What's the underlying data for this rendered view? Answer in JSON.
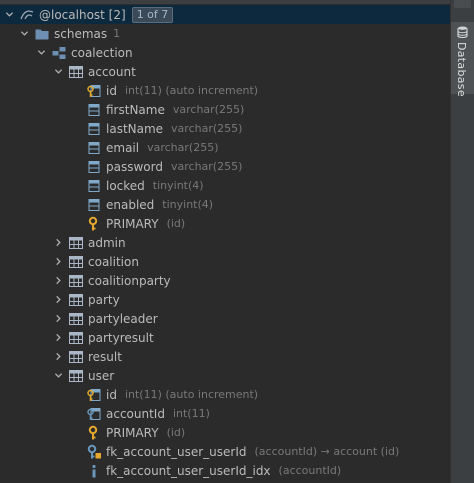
{
  "colors": {
    "background": "#2b2b2b",
    "selected_row": "#0d293e",
    "text": "#bbbbbb",
    "dim_text": "#787878",
    "key_icon": "#e3a82d",
    "table_icon": "#a9b7c6"
  },
  "datasource": {
    "name": "@localhost [2]",
    "badge": "1 of 7"
  },
  "schemas": {
    "label": "schemas",
    "count": "1"
  },
  "schema": {
    "name": "coalection"
  },
  "tables": {
    "account": {
      "name": "account",
      "columns": [
        {
          "name": "id",
          "type": "int(11) (auto increment)",
          "icon": "primary-key-column-icon"
        },
        {
          "name": "firstName",
          "type": "varchar(255)",
          "icon": "column-icon"
        },
        {
          "name": "lastName",
          "type": "varchar(255)",
          "icon": "column-icon"
        },
        {
          "name": "email",
          "type": "varchar(255)",
          "icon": "column-icon"
        },
        {
          "name": "password",
          "type": "varchar(255)",
          "icon": "column-icon"
        },
        {
          "name": "locked",
          "type": "tinyint(4)",
          "icon": "column-icon"
        },
        {
          "name": "enabled",
          "type": "tinyint(4)",
          "icon": "column-icon"
        }
      ],
      "key": {
        "name": "PRIMARY",
        "detail": "(id)",
        "icon": "key-icon"
      }
    },
    "collapsed": [
      "admin",
      "coalition",
      "coalitionparty",
      "party",
      "partyleader",
      "partyresult",
      "result"
    ],
    "user": {
      "name": "user",
      "columns": [
        {
          "name": "id",
          "type": "int(11) (auto increment)",
          "icon": "primary-key-column-icon"
        },
        {
          "name": "accountId",
          "type": "int(11)",
          "icon": "foreign-key-column-icon"
        }
      ],
      "key": {
        "name": "PRIMARY",
        "detail": "(id)",
        "icon": "key-icon"
      },
      "foreign_key": {
        "name": "fk_account_user_userId",
        "detail": "(accountId) → account (id)",
        "icon": "foreign-key-icon"
      },
      "index": {
        "name": "fk_account_user_userId_idx",
        "detail": "(accountId)",
        "icon": "index-icon"
      }
    }
  },
  "sidebar": {
    "database_tab": "Database"
  }
}
